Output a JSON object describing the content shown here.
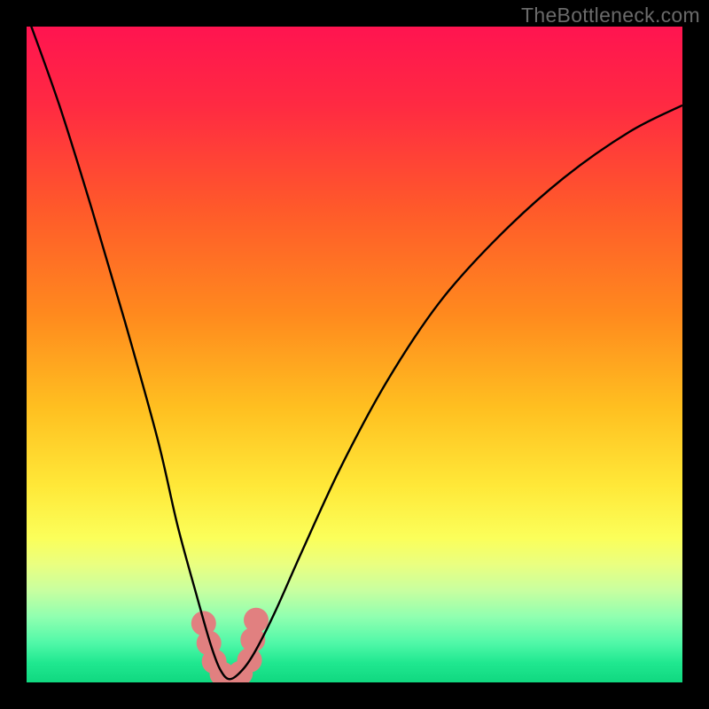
{
  "watermark": "TheBottleneck.com",
  "colors": {
    "frame": "#000000",
    "gradient_stops": [
      {
        "offset": 0.0,
        "color": "#ff1450"
      },
      {
        "offset": 0.12,
        "color": "#ff2a42"
      },
      {
        "offset": 0.28,
        "color": "#ff5a2a"
      },
      {
        "offset": 0.44,
        "color": "#ff8a1e"
      },
      {
        "offset": 0.58,
        "color": "#ffbf20"
      },
      {
        "offset": 0.7,
        "color": "#ffe838"
      },
      {
        "offset": 0.78,
        "color": "#fbff5a"
      },
      {
        "offset": 0.82,
        "color": "#eaff80"
      },
      {
        "offset": 0.86,
        "color": "#c8ffa0"
      },
      {
        "offset": 0.9,
        "color": "#90ffb0"
      },
      {
        "offset": 0.94,
        "color": "#50f8a8"
      },
      {
        "offset": 0.97,
        "color": "#20e890"
      },
      {
        "offset": 1.0,
        "color": "#10d880"
      }
    ],
    "curve": "#000000",
    "marker": "#e18080"
  },
  "chart_data": {
    "type": "line",
    "title": "",
    "xlabel": "",
    "ylabel": "",
    "xlim": [
      0,
      100
    ],
    "ylim": [
      0,
      100
    ],
    "annotations": [],
    "series": [
      {
        "name": "bottleneck-curve",
        "x": [
          0,
          5,
          10,
          15,
          20,
          23,
          26,
          28,
          29.5,
          31,
          33,
          35,
          38,
          42,
          48,
          55,
          63,
          72,
          82,
          92,
          100
        ],
        "y": [
          102,
          88,
          72,
          55,
          37,
          24,
          13,
          6,
          2,
          0.5,
          2,
          5,
          11,
          20,
          33,
          46,
          58,
          68,
          77,
          84,
          88
        ]
      }
    ],
    "markers": {
      "name": "highlight-region",
      "points": [
        {
          "x": 27.0,
          "y": 9.0
        },
        {
          "x": 27.8,
          "y": 6.0
        },
        {
          "x": 28.6,
          "y": 3.2
        },
        {
          "x": 29.8,
          "y": 1.3
        },
        {
          "x": 31.2,
          "y": 0.6
        },
        {
          "x": 32.6,
          "y": 1.4
        },
        {
          "x": 34.0,
          "y": 3.4
        },
        {
          "x": 34.5,
          "y": 6.5
        },
        {
          "x": 35.0,
          "y": 9.5
        }
      ],
      "radius": 14
    }
  }
}
